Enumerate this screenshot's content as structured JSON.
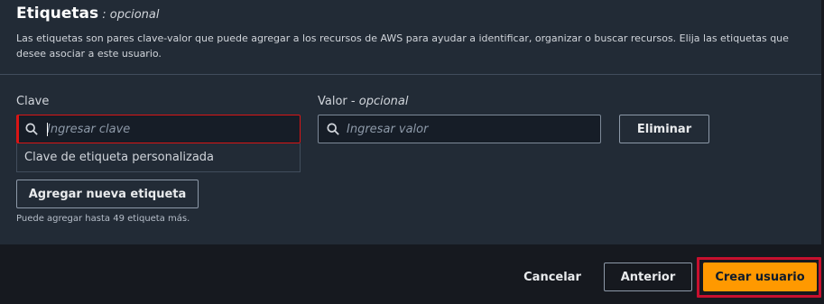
{
  "tags_section": {
    "title": "Etiquetas",
    "title_suffix": " : ",
    "optional": "opcional",
    "description": "Las etiquetas son pares clave-valor que puede agregar a los recursos de AWS para ayudar a identificar, organizar o buscar recursos. Elija las etiquetas que desee asociar a este usuario."
  },
  "tag_row": {
    "key_label": "Clave",
    "key_placeholder": "Ingresar clave",
    "value_label": "Valor",
    "value_label_sep": " - ",
    "value_optional": "opcional",
    "value_placeholder": "Ingresar valor",
    "remove_label": "Eliminar",
    "key_suggestion": "Clave de etiqueta personalizada"
  },
  "add_tag": {
    "label": "Agregar nueva etiqueta",
    "hint": "Puede agregar hasta 49 etiqueta más."
  },
  "footer": {
    "cancel_label": "Cancelar",
    "previous_label": "Anterior",
    "create_label": "Crear usuario"
  },
  "colors": {
    "primary": "#ff9900",
    "error_border": "#d91515",
    "highlight": "#c8102e"
  },
  "icons": [
    "search-icon"
  ]
}
